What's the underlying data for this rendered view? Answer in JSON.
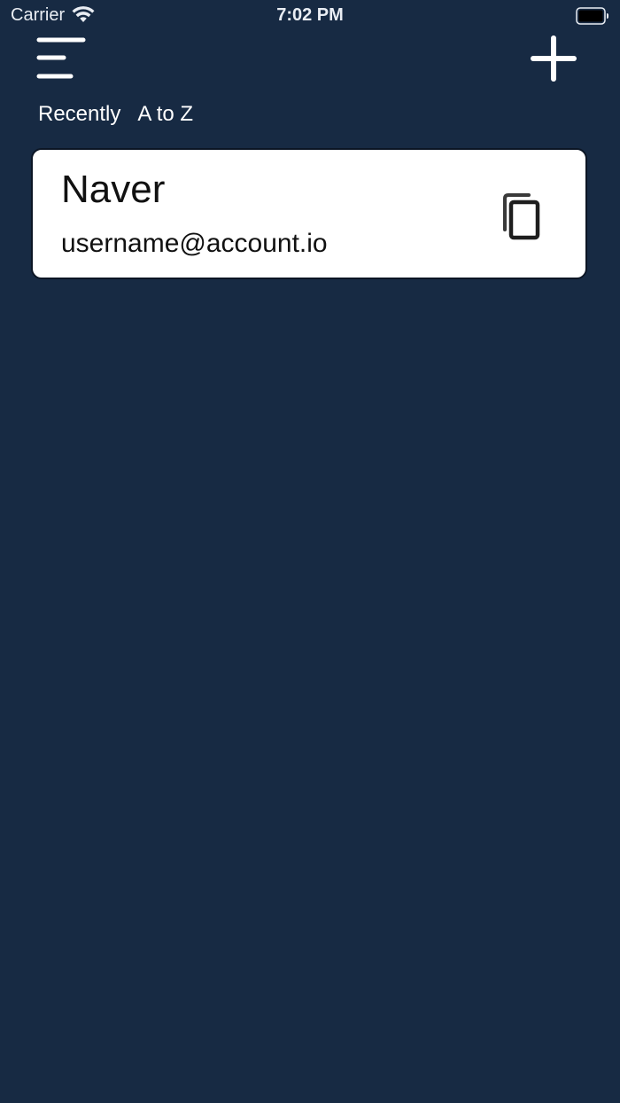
{
  "status_bar": {
    "carrier": "Carrier",
    "time": "7:02 PM",
    "wifi_icon": "wifi-icon",
    "battery_icon": "battery-icon"
  },
  "header": {
    "menu_icon": "menu-icon",
    "add_icon": "plus-icon"
  },
  "sort_tabs": [
    {
      "label": "Recently"
    },
    {
      "label": "A to Z"
    }
  ],
  "accounts": [
    {
      "title": "Naver",
      "username": "username@account.io",
      "copy_icon": "copy-icon"
    }
  ],
  "colors": {
    "background": "#172a43",
    "card": "#ffffff",
    "text_light": "#ffffff",
    "text_dark": "#111111"
  }
}
